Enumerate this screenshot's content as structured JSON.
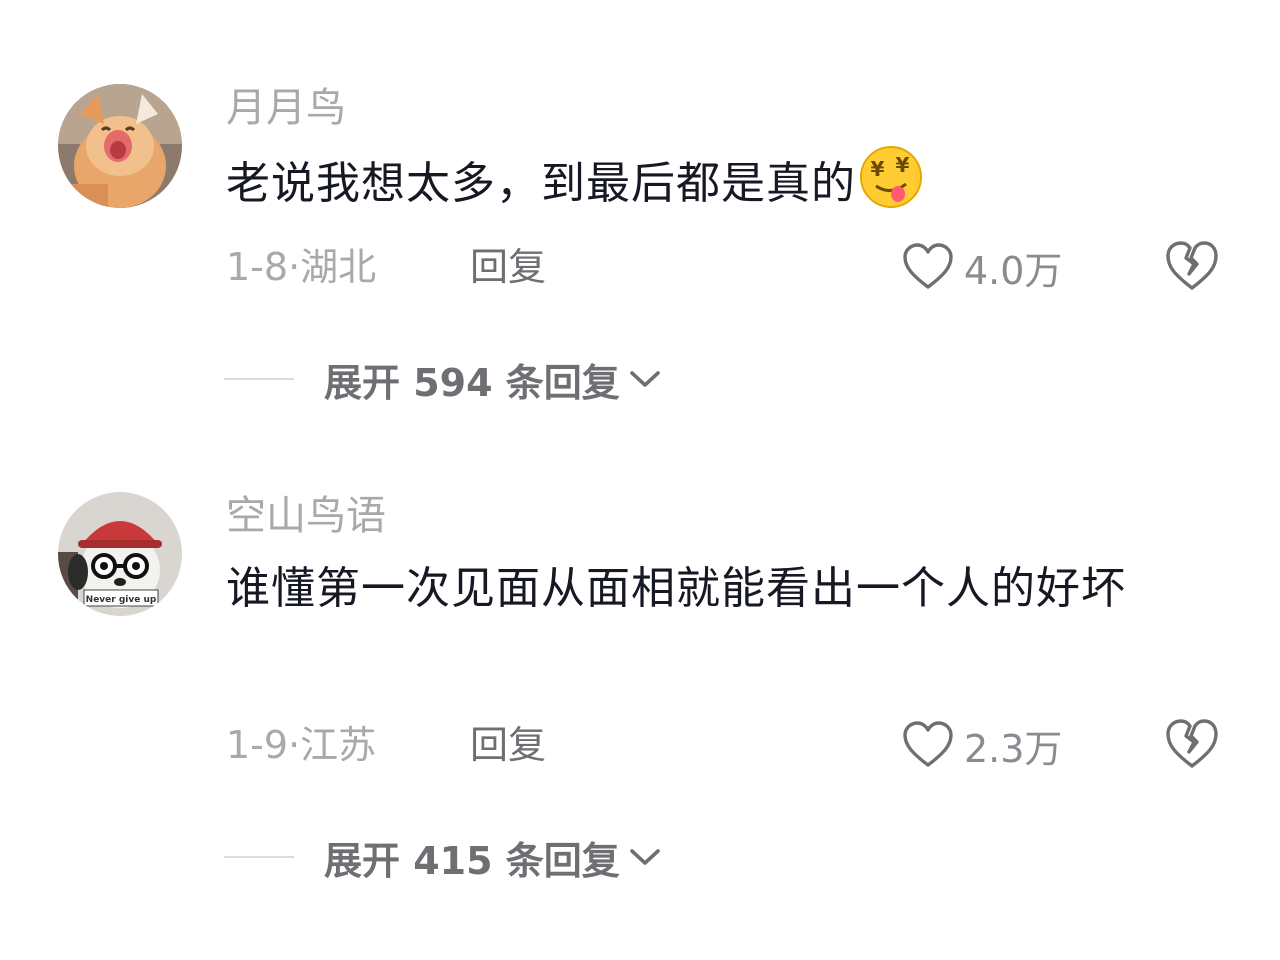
{
  "comments": [
    {
      "username": "月月鸟",
      "avatar_icon": "kitten-avatar",
      "text": "老说我想太多，到最后都是真的",
      "emoji": "money-eyes-tongue-emoji",
      "meta": "1-8·湖北",
      "reply_label": "回复",
      "like_count": "4.0万",
      "expand_label": "展开 594 条回复"
    },
    {
      "username": "空山鸟语",
      "avatar_icon": "plush-dog-avatar",
      "avatar_badge_text": "Never give up",
      "text": "谁懂第一次见面从面相就能看出一个人的好坏",
      "meta": "1-9·江苏",
      "reply_label": "回复",
      "like_count": "2.3万",
      "expand_label": "展开 415 条回复"
    }
  ],
  "colors": {
    "primary_text": "#161823",
    "secondary_text": "#a8a8ad",
    "action_text": "#6e6e73",
    "background": "#ffffff"
  }
}
